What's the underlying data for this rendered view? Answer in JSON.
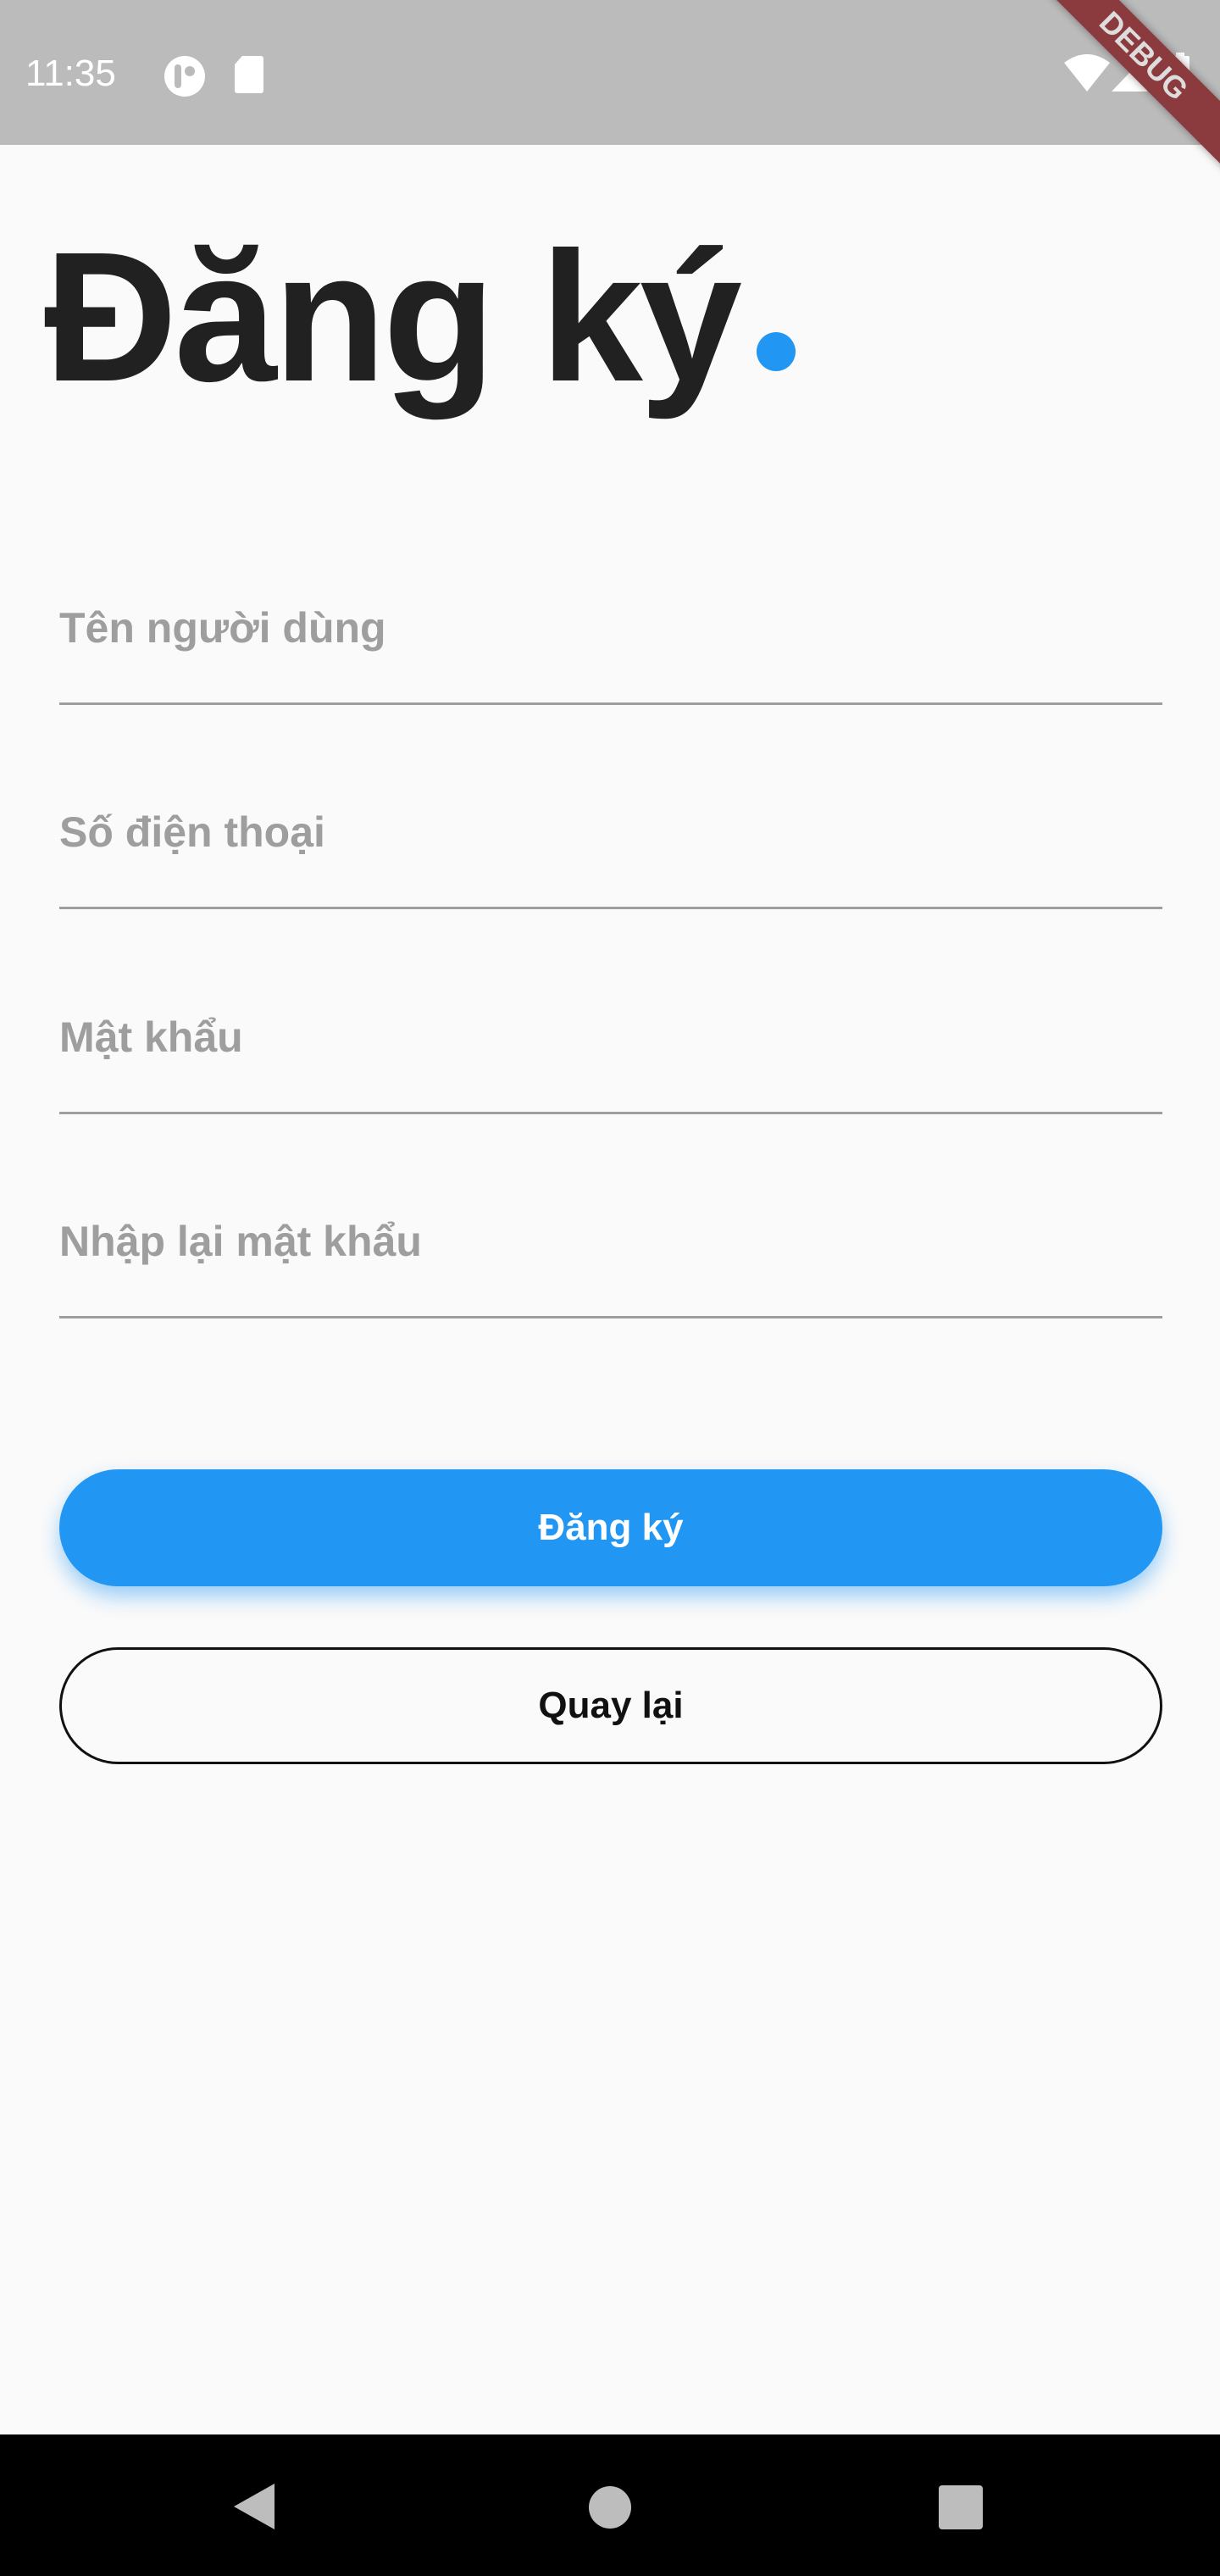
{
  "status_bar": {
    "time": "11:35",
    "icons": [
      "app-notification-icon",
      "sd-card-icon",
      "wifi-icon",
      "signal-icon",
      "battery-charging-icon"
    ]
  },
  "debug_banner": "DEBUG",
  "page": {
    "title": "Đăng ký"
  },
  "form": {
    "fields": [
      {
        "placeholder": "Tên người dùng"
      },
      {
        "placeholder": "Số điện thoại"
      },
      {
        "placeholder": "Mật khẩu"
      },
      {
        "placeholder": "Nhập lại mật khẩu"
      }
    ],
    "register_label": "Đăng ký",
    "back_label": "Quay lại"
  },
  "colors": {
    "accent": "#2196f3",
    "status_bar": "#bbbbbb"
  }
}
